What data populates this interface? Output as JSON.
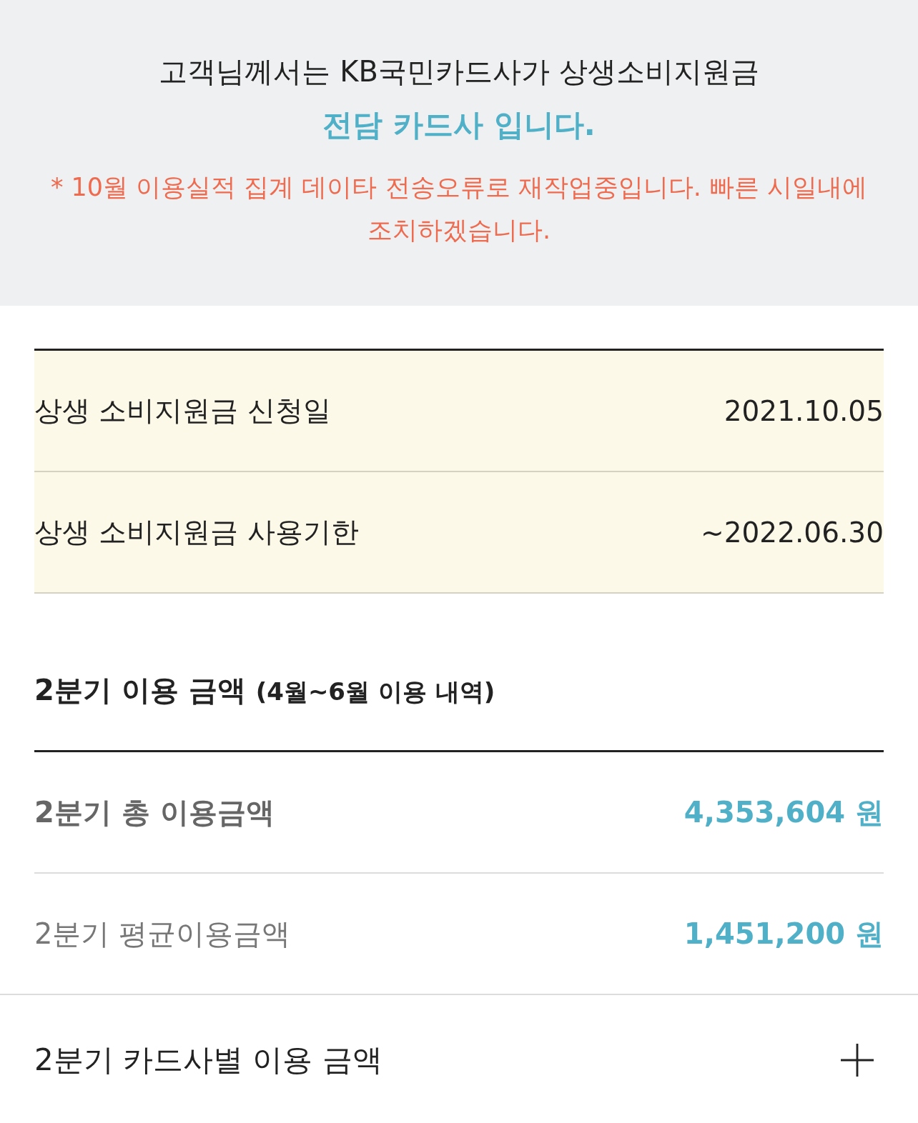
{
  "notice": {
    "message": "고객님께서는 KB국민카드사가 상생소비지원금",
    "highlight": "전담 카드사 입니다.",
    "warning": "* 10월 이용실적 집계 데이타 전송오류로 재작업중입니다. 빠른 시일내에 조치하겠습니다."
  },
  "period_table": {
    "rows": [
      {
        "label": "상생 소비지원금 신청일",
        "value": "2021.10.05"
      },
      {
        "label": "상생 소비지원금 사용기한",
        "value": "~2022.06.30"
      }
    ]
  },
  "quarter_usage": {
    "title": "2분기 이용 금액",
    "subtitle": "(4월~6월 이용 내역)",
    "rows": [
      {
        "kind": "total",
        "label": "2분기 총 이용금액",
        "value": "4,353,604 원"
      },
      {
        "kind": "average",
        "label": "2분기 평균이용금액",
        "value": "1,451,200 원"
      }
    ]
  },
  "card_breakdown": {
    "label": "2분기 카드사별 이용 금액",
    "expanded": false
  }
}
